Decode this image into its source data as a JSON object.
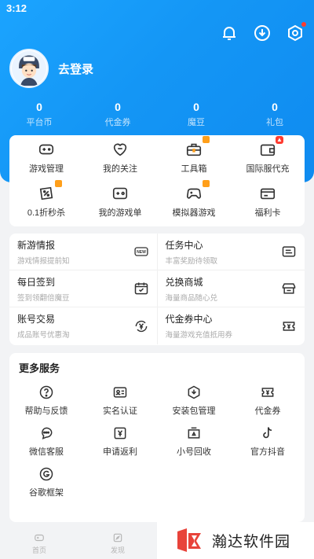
{
  "status": {
    "time": "3:12"
  },
  "colors": {
    "accent": "#1496f5",
    "badge_orange": "#ff9f1a",
    "badge_red": "#ff3b30"
  },
  "header": {
    "icons": [
      "bell-icon",
      "download-icon",
      "settings-icon"
    ]
  },
  "user": {
    "login_label": "去登录"
  },
  "stats": [
    {
      "value": "0",
      "label": "平台币"
    },
    {
      "value": "0",
      "label": "代金券"
    },
    {
      "value": "0",
      "label": "魔豆"
    },
    {
      "value": "0",
      "label": "礼包"
    }
  ],
  "quick": [
    {
      "label": "游戏管理",
      "icon": "gamepad-icon"
    },
    {
      "label": "我的关注",
      "icon": "heart-icon"
    },
    {
      "label": "工具箱",
      "icon": "toolbox-icon"
    },
    {
      "label": "国际服代充",
      "icon": "wallet-icon"
    },
    {
      "label": "0.1折秒杀",
      "icon": "discount-icon"
    },
    {
      "label": "我的游戏单",
      "icon": "game-list-icon"
    },
    {
      "label": "模拟器游戏",
      "icon": "emulator-icon"
    },
    {
      "label": "福利卡",
      "icon": "card-icon"
    }
  ],
  "features": [
    {
      "title": "新游情报",
      "sub": "游戏情报提前知",
      "icon": "new-icon"
    },
    {
      "title": "任务中心",
      "sub": "丰富奖励待领取",
      "icon": "task-icon"
    },
    {
      "title": "每日签到",
      "sub": "签到领翻倍魔豆",
      "icon": "calendar-icon"
    },
    {
      "title": "兑换商城",
      "sub": "海量商品随心兑",
      "icon": "shop-icon"
    },
    {
      "title": "账号交易",
      "sub": "成品账号优惠淘",
      "icon": "yen-exchange-icon"
    },
    {
      "title": "代金券中心",
      "sub": "海量游戏充值抵用券",
      "icon": "coupon-icon"
    }
  ],
  "more": {
    "title": "更多服务",
    "items": [
      {
        "label": "帮助与反馈",
        "icon": "help-icon"
      },
      {
        "label": "实名认证",
        "icon": "id-card-icon"
      },
      {
        "label": "安装包管理",
        "icon": "package-icon"
      },
      {
        "label": "代金券",
        "icon": "voucher-icon"
      },
      {
        "label": "微信客服",
        "icon": "wechat-icon"
      },
      {
        "label": "申请返利",
        "icon": "rebate-icon"
      },
      {
        "label": "小号回收",
        "icon": "recycle-icon"
      },
      {
        "label": "官方抖音",
        "icon": "douyin-icon"
      },
      {
        "label": "谷歌框架",
        "icon": "google-icon"
      }
    ]
  },
  "tabbar": [
    {
      "label": "首页",
      "icon": "home-icon"
    },
    {
      "label": "发现",
      "icon": "discover-icon"
    }
  ],
  "watermark": {
    "text": "瀚达软件园"
  }
}
